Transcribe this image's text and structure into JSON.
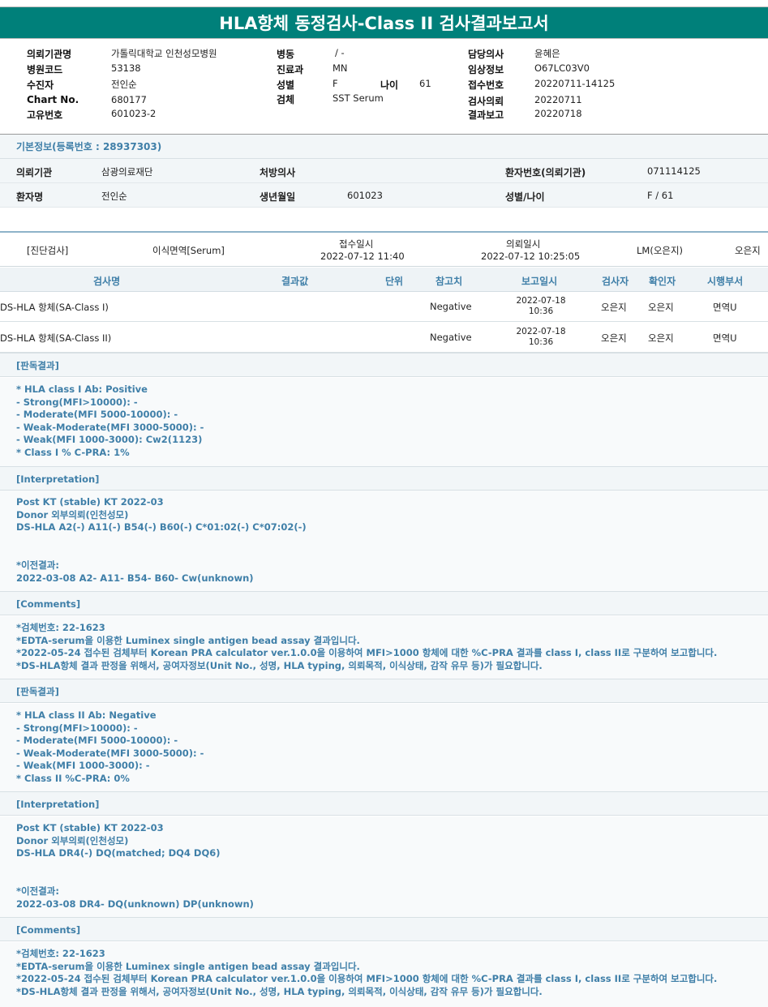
{
  "title": "HLA항체 동정검사-Class II 검사결과보고서",
  "header": {
    "col1": [
      {
        "label": "의뢰기관명",
        "value": "가톨릭대학교 인천성모병원"
      },
      {
        "label": "병원코드",
        "value": "53138"
      },
      {
        "label": "수진자",
        "value": "전인순"
      },
      {
        "label": "Chart No.",
        "value": "680177"
      },
      {
        "label": "고유번호",
        "value": "601023-2"
      }
    ],
    "col2": [
      {
        "label": "병동",
        "value": "/ -"
      },
      {
        "label": "진료과",
        "value": "MN"
      },
      {
        "label": "성별",
        "value": "F"
      },
      {
        "label": "검체",
        "value": "SST Serum"
      }
    ],
    "age_label": "나이",
    "age_value": "61",
    "col3": [
      {
        "label": "담당의사",
        "value": "윤혜은"
      },
      {
        "label": "임상정보",
        "value": "O67LC03V0"
      },
      {
        "label": "접수번호",
        "value": "20220711-14125"
      },
      {
        "label": "검사의뢰",
        "value": "20220711"
      },
      {
        "label": "결과보고",
        "value": "20220718"
      }
    ]
  },
  "basic_info": {
    "heading": "기본정보(등록번호 : 28937303)",
    "row1": {
      "l1": "의뢰기관",
      "v1": "삼광의료재단",
      "l2": "처방의사",
      "v2": "",
      "l3": "환자번호(의뢰기관)",
      "v3": "071114125"
    },
    "row2": {
      "l1": "환자명",
      "v1": "전인순",
      "l2": "생년월일",
      "v2": "601023",
      "l3": "성별/나이",
      "v3": "F / 61"
    }
  },
  "diagnosis": {
    "label": "[진단검사]",
    "dept": "이식면역[Serum]",
    "received_label": "접수일시",
    "received": "2022-07-12  11:40",
    "requested_label": "의뢰일시",
    "requested": "2022-07-12  10:25:05",
    "doctor": "LM(오은지)",
    "tester": "오은지"
  },
  "results_table": {
    "headers": [
      "검사명",
      "결과값",
      "단위",
      "참고치",
      "보고일시",
      "검사자",
      "확인자",
      "시행부서"
    ],
    "rows": [
      {
        "name": "DS-HLA 항체(SA-Class I)",
        "result": "",
        "unit": "",
        "ref": "Negative",
        "date": "2022-07-18",
        "time": "10:36",
        "tester": "오은지",
        "checker": "오은지",
        "dept": "면역U"
      },
      {
        "name": "DS-HLA 항체(SA-Class II)",
        "result": "",
        "unit": "",
        "ref": "Negative",
        "date": "2022-07-18",
        "time": "10:36",
        "tester": "오은지",
        "checker": "오은지",
        "dept": "면역U"
      }
    ]
  },
  "sections": [
    {
      "heading": "[판독결과]",
      "lines": [
        "* HLA class I Ab: Positive",
        "- Strong(MFI>10000): -",
        "- Moderate(MFI 5000-10000): -",
        "- Weak-Moderate(MFI 3000-5000): -",
        "- Weak(MFI 1000-3000): Cw2(1123)",
        "* Class I % C-PRA: 1%"
      ]
    },
    {
      "heading": "[Interpretation]",
      "lines": [
        "Post KT (stable) KT 2022-03",
        "Donor 외부의뢰(인천성모)",
        "DS-HLA A2(-) A11(-) B54(-) B60(-) C*01:02(-) C*07:02(-)",
        "",
        "",
        "*이전결과:",
        "2022-03-08 A2- A11- B54- B60- Cw(unknown)"
      ]
    },
    {
      "heading": "[Comments]",
      "lines": [
        "*검체번호: 22-1623",
        "*EDTA-serum을 이용한 Luminex single antigen bead assay 결과입니다.",
        "*2022-05-24 접수된 검체부터 Korean PRA calculator ver.1.0.0을 이용하여 MFI>1000 항체에 대한 %C-PRA 결과를 class I, class II로 구분하여 보고합니다.",
        "*DS-HLA항체 결과 판정을 위해서, 공여자정보(Unit No., 성명, HLA typing, 의뢰목적, 이식상태, 감작 유무 등)가 필요합니다."
      ]
    },
    {
      "heading": "[판독결과]",
      "lines": [
        "* HLA class II Ab: Negative",
        "- Strong(MFI>10000): -",
        "- Moderate(MFI 5000-10000): -",
        "- Weak-Moderate(MFI 3000-5000): -",
        "- Weak(MFI 1000-3000): -",
        "* Class II %C-PRA: 0%"
      ]
    },
    {
      "heading": "[Interpretation]",
      "lines": [
        "Post KT (stable) KT 2022-03",
        "Donor 외부의뢰(인천성모)",
        "DS-HLA DR4(-) DQ(matched; DQ4 DQ6)",
        "",
        "",
        "*이전결과:",
        "2022-03-08 DR4- DQ(unknown) DP(unknown)"
      ]
    },
    {
      "heading": "[Comments]",
      "lines": [
        "*검체번호: 22-1623",
        "*EDTA-serum을 이용한 Luminex single antigen bead assay 결과입니다.",
        "*2022-05-24 접수된 검체부터 Korean PRA calculator ver.1.0.0을 이용하여 MFI>1000 항체에 대한 %C-PRA 결과를 class I, class II로 구분하여 보고합니다.",
        "*DS-HLA항체 결과 판정을 위해서, 공여자정보(Unit No., 성명, HLA typing, 의뢰목적, 이식상태, 감작 유무 등)가 필요합니다."
      ]
    }
  ]
}
